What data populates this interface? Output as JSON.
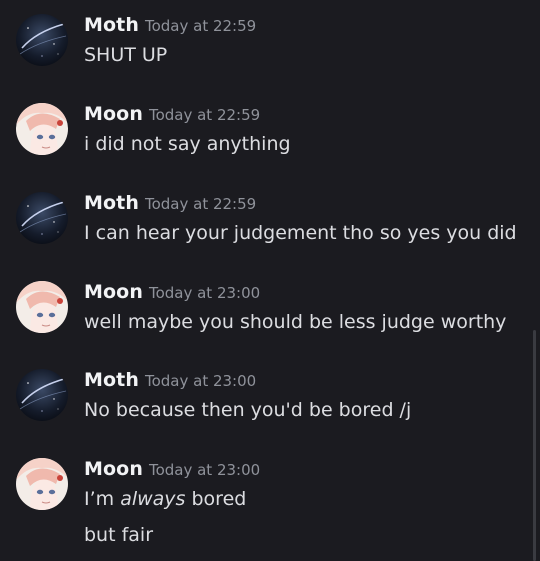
{
  "messages": [
    {
      "author": "Moth",
      "time": "Today at 22:59",
      "avatar": "moth-avatar",
      "lines": [
        "SHUT UP"
      ]
    },
    {
      "author": "Moon",
      "time": "Today at 22:59",
      "avatar": "moon-avatar",
      "lines": [
        "i did not say anything"
      ]
    },
    {
      "author": "Moth",
      "time": "Today at 22:59",
      "avatar": "moth-avatar",
      "lines": [
        "I can hear your judgement tho so yes you did"
      ]
    },
    {
      "author": "Moon",
      "time": "Today at 23:00",
      "avatar": "moon-avatar",
      "lines": [
        "well maybe you should be less judge worthy"
      ]
    },
    {
      "author": "Moth",
      "time": "Today at 23:00",
      "avatar": "moth-avatar",
      "lines": [
        "No because then you'd be bored /j"
      ]
    },
    {
      "author": "Moon",
      "time": "Today at 23:00",
      "avatar": "moon-avatar",
      "lines_rich": {
        "prefix": "I’m ",
        "emphasis": "always",
        "suffix": " bored"
      },
      "lines": [
        "but fair"
      ]
    }
  ],
  "colors": {
    "background": "#1b1b20",
    "author": "#f2f3f5",
    "timestamp": "#8f929a",
    "text": "#dcdde1"
  }
}
